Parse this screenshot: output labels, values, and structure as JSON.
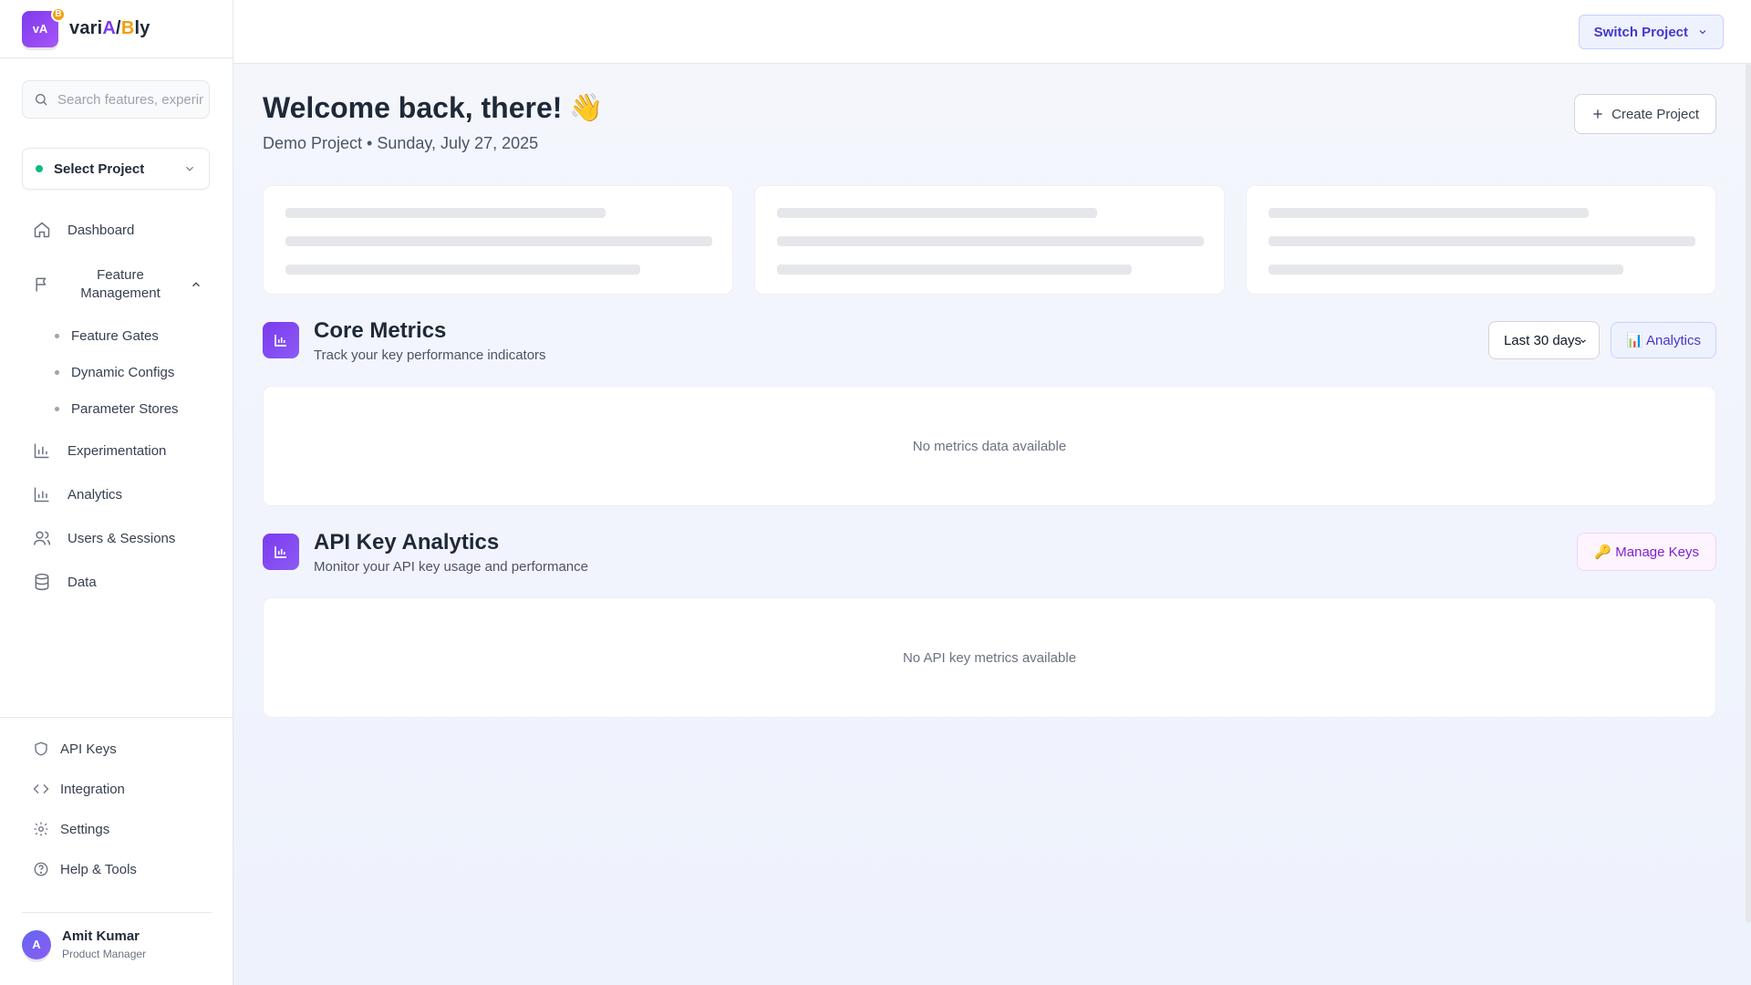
{
  "brand": {
    "logo_text": "vA",
    "badge": "B",
    "name_part1": "vari",
    "name_part2": "A",
    "name_part3": "/",
    "name_part4": "B",
    "name_part5": "ly"
  },
  "search": {
    "placeholder": "Search features, experiments..."
  },
  "project_select": {
    "label": "Select Project"
  },
  "nav": {
    "dashboard": "Dashboard",
    "feature_management": "Feature Management",
    "sub_items": [
      "Feature Gates",
      "Dynamic Configs",
      "Parameter Stores"
    ],
    "experimentation": "Experimentation",
    "analytics": "Analytics",
    "users_sessions": "Users & Sessions",
    "data": "Data"
  },
  "bottom_nav": {
    "api_keys": "API Keys",
    "integration": "Integration",
    "settings": "Settings",
    "help_tools": "Help & Tools"
  },
  "user": {
    "initial": "A",
    "name": "Amit Kumar",
    "role": "Product Manager"
  },
  "topbar": {
    "switch_project": "Switch Project"
  },
  "welcome": {
    "title": "Welcome back, there!",
    "emoji": "👋",
    "subtitle": "Demo Project • Sunday, July 27, 2025",
    "create_project": "Create Project"
  },
  "core_metrics": {
    "title": "Core Metrics",
    "subtitle": "Track your key performance indicators",
    "range": "Last 30 days",
    "analytics_button": "📊 Analytics",
    "empty": "No metrics data available"
  },
  "api_analytics": {
    "title": "API Key Analytics",
    "subtitle": "Monitor your API key usage and performance",
    "manage_button": "🔑 Manage Keys",
    "empty": "No API key metrics available"
  },
  "colors": {
    "accent": "#7c3aed",
    "brand_b": "#f59e0b",
    "status_green": "#10b981",
    "indigo": "#4338ca"
  }
}
